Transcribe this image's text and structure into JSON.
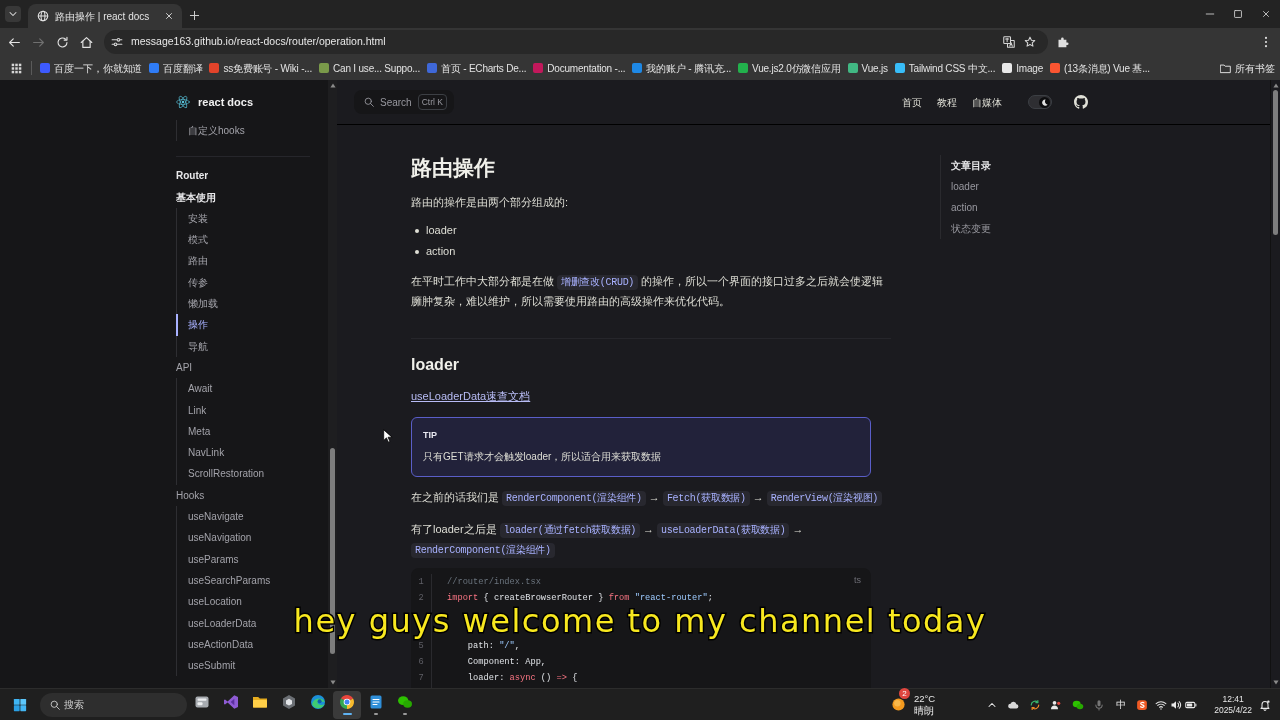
{
  "browser": {
    "tab": {
      "title": "路由操作 | react docs",
      "selected": true
    },
    "nav_buttons": [
      {
        "kind": "back",
        "disabled": false
      },
      {
        "kind": "forward",
        "disabled": true
      },
      {
        "kind": "reload",
        "disabled": false
      },
      {
        "kind": "home",
        "disabled": false
      }
    ],
    "address": "message163.github.io/react-docs/router/operation.html",
    "bookmarks": [
      {
        "label": "百度一下，你就知道",
        "color": "#3d5afe"
      },
      {
        "label": "百度翻译",
        "color": "#2f7cf6"
      },
      {
        "label": "ss免费账号 - Wiki -...",
        "color": "#e2432a"
      },
      {
        "label": "Can I use... Suppo...",
        "color": "#7a9a4a"
      },
      {
        "label": "首页 - ECharts De...",
        "color": "#3f68d8"
      },
      {
        "label": "Documentation -...",
        "color": "#c2185b"
      },
      {
        "label": "我的账户 - 腾讯充...",
        "color": "#1e88e5"
      },
      {
        "label": "Vue.js2.0仿微信应用",
        "color": "#22b14c"
      },
      {
        "label": "Vue.js",
        "color": "#41b883"
      },
      {
        "label": "Tailwind CSS 中文...",
        "color": "#38bdf8"
      },
      {
        "label": "Image",
        "color": "#e8e8e8"
      },
      {
        "label": "(13条消息) Vue 基...",
        "color": "#fc5531"
      }
    ],
    "all_bookmarks": "所有书签"
  },
  "site": {
    "logo": "react docs",
    "search": {
      "label": "Search",
      "shortcut": "Ctrl K"
    },
    "nav": [
      "首页",
      "教程",
      "自媒体"
    ],
    "appearance_switch": {
      "on": true
    }
  },
  "sidebar": {
    "items_above": [
      {
        "label": "自定义hooks",
        "selected": false
      }
    ],
    "sections": [
      {
        "title": "Router",
        "children": [
          {
            "label": "基本使用",
            "children": [
              {
                "label": "安装",
                "selected": false
              },
              {
                "label": "模式",
                "selected": false
              },
              {
                "label": "路由",
                "selected": false
              },
              {
                "label": "传参",
                "selected": false
              },
              {
                "label": "懒加载",
                "selected": false
              },
              {
                "label": "操作",
                "selected": true
              },
              {
                "label": "导航",
                "selected": false
              }
            ]
          },
          {
            "label": "API",
            "children": [
              {
                "label": "Await",
                "selected": false
              },
              {
                "label": "Link",
                "selected": false
              },
              {
                "label": "Meta",
                "selected": false
              },
              {
                "label": "NavLink",
                "selected": false
              },
              {
                "label": "ScrollRestoration",
                "selected": false
              }
            ]
          },
          {
            "label": "Hooks",
            "children": [
              {
                "label": "useNavigate",
                "selected": false
              },
              {
                "label": "useNavigation",
                "selected": false
              },
              {
                "label": "useParams",
                "selected": false
              },
              {
                "label": "useSearchParams",
                "selected": false
              },
              {
                "label": "useLocation",
                "selected": false
              },
              {
                "label": "useLoaderData",
                "selected": false
              },
              {
                "label": "useActionData",
                "selected": false
              },
              {
                "label": "useSubmit",
                "selected": false
              }
            ]
          }
        ]
      }
    ]
  },
  "article": {
    "title": "路由操作",
    "blocks": [
      {
        "kind": "paragraph",
        "segments": [
          {
            "kind": "text",
            "text": "路由的操作是由两个部分组成的:"
          }
        ]
      },
      {
        "kind": "list",
        "items": [
          "loader",
          "action"
        ]
      },
      {
        "kind": "paragraph",
        "segments": [
          {
            "kind": "text",
            "text": "在平时工作中大部分都是在做 "
          },
          {
            "kind": "code",
            "text": "增删查改(CRUD)"
          },
          {
            "kind": "text",
            "text": " 的操作，所以一个界面的接口过多之后就会使逻辑臃肿复杂，难以维护，所以需要使用路由的高级操作来优化代码。"
          }
        ]
      },
      {
        "kind": "divider"
      },
      {
        "kind": "heading",
        "text": "loader"
      },
      {
        "kind": "link",
        "text": "useLoaderData速查文档"
      },
      {
        "kind": "tip",
        "title": "TIP",
        "text": "只有GET请求才会触发loader，所以适合用来获取数据"
      },
      {
        "kind": "paragraph",
        "segments": [
          {
            "kind": "text",
            "text": "在之前的话我们是 "
          },
          {
            "kind": "code",
            "text": "RenderComponent(渲染组件)"
          },
          {
            "kind": "text",
            "text": " → "
          },
          {
            "kind": "code",
            "text": "Fetch(获取数据)"
          },
          {
            "kind": "text",
            "text": " → "
          },
          {
            "kind": "code",
            "text": "RenderView(渲染视图)"
          }
        ]
      },
      {
        "kind": "paragraph",
        "segments": [
          {
            "kind": "text",
            "text": "有了loader之后是 "
          },
          {
            "kind": "code",
            "text": "loader(通过fetch获取数据)"
          },
          {
            "kind": "text",
            "text": " → "
          },
          {
            "kind": "code",
            "text": "useLoaderData(获取数据)"
          },
          {
            "kind": "text",
            "text": " → "
          },
          {
            "kind": "code",
            "text": "RenderComponent(渲染组件)"
          }
        ]
      },
      {
        "kind": "code",
        "lang": "ts",
        "lines": [
          {
            "number": "1",
            "tokens": [
              {
                "kind": "comment",
                "text": "//router/index.tsx"
              }
            ]
          },
          {
            "number": "2",
            "tokens": [
              {
                "kind": "keyword",
                "text": "import"
              },
              {
                "kind": "plain",
                "text": " { createBrowserRouter } "
              },
              {
                "kind": "keyword",
                "text": "from"
              },
              {
                "kind": "string",
                "text": " \"react-router\""
              },
              {
                "kind": "plain",
                "text": ";"
              }
            ]
          },
          {
            "covered": true
          },
          {
            "covered": true
          },
          {
            "number": "5",
            "tokens": [
              {
                "kind": "plain",
                "text": "    path: "
              },
              {
                "kind": "string",
                "text": "\"/\""
              },
              {
                "kind": "plain",
                "text": ","
              }
            ]
          },
          {
            "number": "6",
            "tokens": [
              {
                "kind": "plain",
                "text": "    Component: App,"
              }
            ]
          },
          {
            "number": "7",
            "tokens": [
              {
                "kind": "plain",
                "text": "    loader: "
              },
              {
                "kind": "keyword",
                "text": "async"
              },
              {
                "kind": "plain",
                "text": " () "
              },
              {
                "kind": "keyword",
                "text": "=>"
              },
              {
                "kind": "plain",
                "text": " {"
              }
            ]
          }
        ]
      }
    ]
  },
  "toc": {
    "title": "文章目录",
    "items": [
      {
        "label": "loader",
        "selected": false
      },
      {
        "label": "action",
        "selected": false
      },
      {
        "label": "状态变更",
        "selected": false
      }
    ]
  },
  "subtitle": "hey guys welcome to my channel today",
  "taskbar": {
    "search": {
      "placeholder": "搜索"
    },
    "apps": [
      {
        "kind": "widgets",
        "running": false,
        "selected": false
      },
      {
        "kind": "visual-studio",
        "running": false,
        "selected": false
      },
      {
        "kind": "files",
        "running": false,
        "selected": false
      },
      {
        "kind": "hexagon-app",
        "running": false,
        "selected": false
      },
      {
        "kind": "edge",
        "running": false,
        "selected": false
      },
      {
        "kind": "chrome",
        "running": true,
        "selected": true
      },
      {
        "kind": "notepad",
        "running": true,
        "selected": false
      },
      {
        "kind": "wechat",
        "running": true,
        "selected": false
      }
    ],
    "weather": {
      "badge": "2",
      "temperature": "22°C",
      "condition": "晴朗"
    },
    "tray": [
      {
        "kind": "chevron"
      },
      {
        "kind": "cloud"
      },
      {
        "kind": "sync"
      },
      {
        "kind": "people"
      },
      {
        "kind": "wechat"
      },
      {
        "kind": "mic"
      },
      {
        "kind": "ime",
        "label": "中"
      },
      {
        "kind": "sogou"
      },
      {
        "kind": "wifi"
      },
      {
        "kind": "volume"
      },
      {
        "kind": "battery"
      }
    ],
    "clock": {
      "time": "12:41",
      "date": "2025/4/22"
    }
  }
}
